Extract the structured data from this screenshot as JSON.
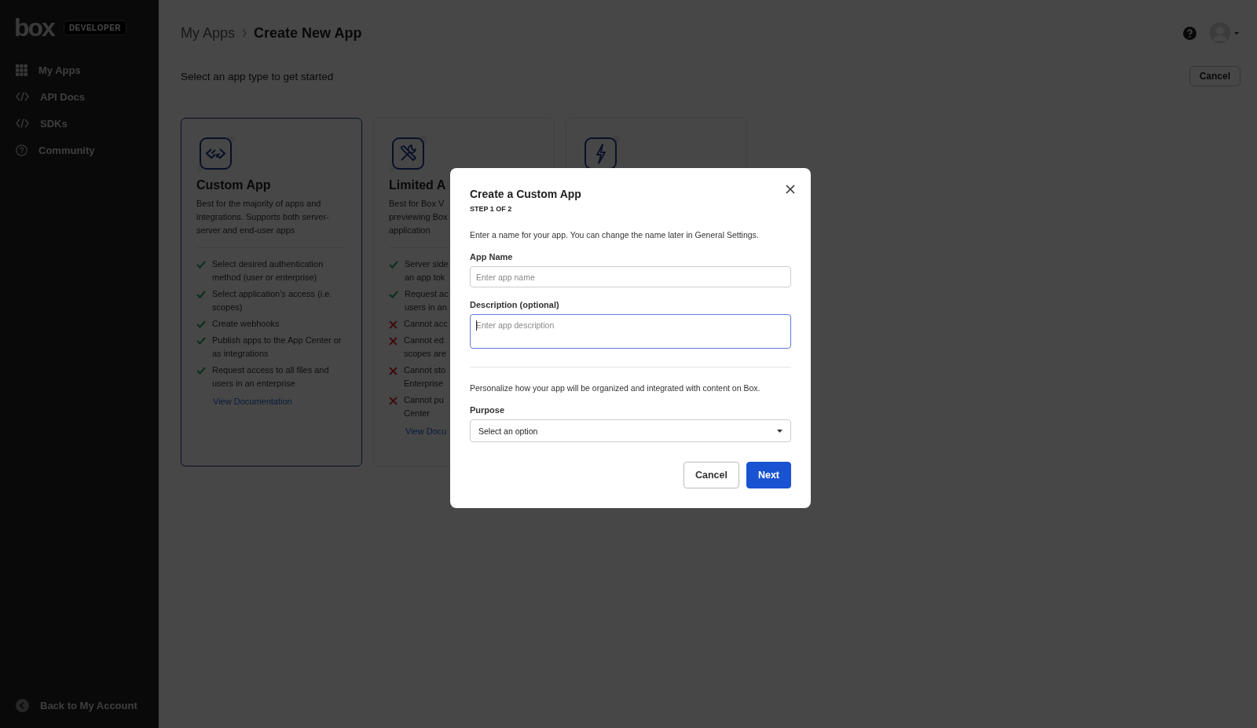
{
  "sidebar": {
    "logo": "box",
    "badge": "DEVELOPER",
    "items": [
      {
        "label": "My Apps"
      },
      {
        "label": "API Docs"
      },
      {
        "label": "SDKs"
      },
      {
        "label": "Community"
      }
    ],
    "footer": {
      "label": "Back to My Account"
    }
  },
  "breadcrumb": [
    {
      "label": "My Apps",
      "current": false
    },
    {
      "label": "Create New App",
      "current": true
    }
  ],
  "subtitle": "Select an app type to get started",
  "header_button": "Cancel",
  "cards": [
    {
      "selected": true,
      "title": "Custom App",
      "description": "Best for the majority of apps and integrations. Supports both server-server and end-user apps",
      "features": [
        {
          "included": true,
          "text": "Select desired authentication method (user or enterprise)"
        },
        {
          "included": true,
          "text": "Select application's access (i.e. scopes)"
        },
        {
          "included": true,
          "text": "Create webhooks"
        },
        {
          "included": true,
          "text": "Publish apps to the App Center or as integrations"
        },
        {
          "included": true,
          "text": "Request access to all files and users in an enterprise"
        }
      ],
      "link": "View Documentation"
    },
    {
      "selected": false,
      "title": "Limited A",
      "description_lines": [
        "Best for Box V",
        "previewing Box",
        "application"
      ],
      "features": [
        {
          "included": true,
          "lines": [
            "Server side",
            "an app tok"
          ]
        },
        {
          "included": true,
          "lines": [
            "Request ac",
            "users in an"
          ]
        },
        {
          "included": false,
          "lines": [
            "Cannot acc"
          ]
        },
        {
          "included": false,
          "lines": [
            "Cannot ed",
            "scopes are"
          ]
        },
        {
          "included": false,
          "lines": [
            "Cannot sto",
            "Enterprise"
          ]
        },
        {
          "included": false,
          "lines": [
            "Cannot pu",
            "Center"
          ]
        }
      ],
      "link": "View Docu"
    },
    {
      "selected": false
    }
  ],
  "modal": {
    "title": "Create a Custom App",
    "step": "STEP 1 OF 2",
    "intro": "Enter a name for your app. You can change the name later in General Settings.",
    "name_field": {
      "label": "App Name",
      "placeholder": "Enter app name",
      "focused": false
    },
    "description_field": {
      "label": "Description (optional)",
      "placeholder": "Enter app description",
      "focused": true
    },
    "personalize": "Personalize how your app will be organized and integrated with content on Box.",
    "purpose": {
      "label": "Purpose",
      "value": "Select an option"
    },
    "buttons": [
      {
        "label": "Cancel",
        "kind": "secondary"
      },
      {
        "label": "Next",
        "kind": "primary"
      }
    ]
  }
}
